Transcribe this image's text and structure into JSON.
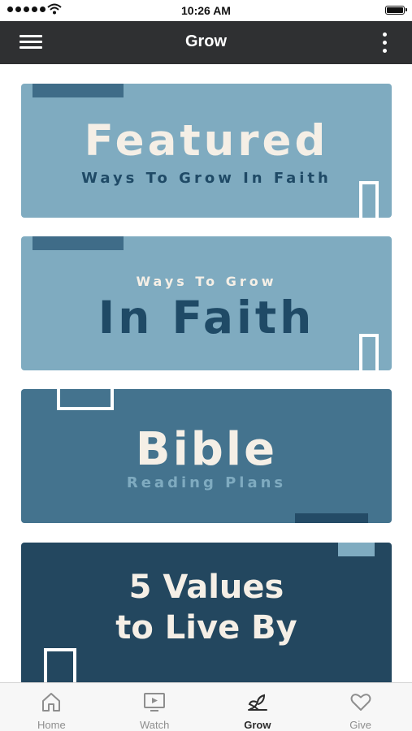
{
  "status_bar": {
    "time": "10:26 AM"
  },
  "nav": {
    "title": "Grow"
  },
  "cards": [
    {
      "name": "featured",
      "big": "Featured",
      "small": "Ways To Grow In Faith"
    },
    {
      "name": "in-faith",
      "small": "Ways To Grow",
      "big": "In Faith"
    },
    {
      "name": "bible",
      "big": "Bible",
      "small": "Reading Plans"
    },
    {
      "name": "values",
      "line1": "5 Values",
      "line2": "to Live By"
    }
  ],
  "tabs": [
    {
      "label": "Home",
      "icon": "home-icon",
      "active": false
    },
    {
      "label": "Watch",
      "icon": "tv-icon",
      "active": false
    },
    {
      "label": "Grow",
      "icon": "sprout-icon",
      "active": true
    },
    {
      "label": "Give",
      "icon": "heart-icon",
      "active": false
    }
  ],
  "colors": {
    "nav_bg": "#2f3032",
    "card_light": "#7fabc0",
    "card_mid": "#44738e",
    "card_dark": "#23475f",
    "accent_navy": "#1f4a66",
    "cream": "#f5efe6"
  }
}
